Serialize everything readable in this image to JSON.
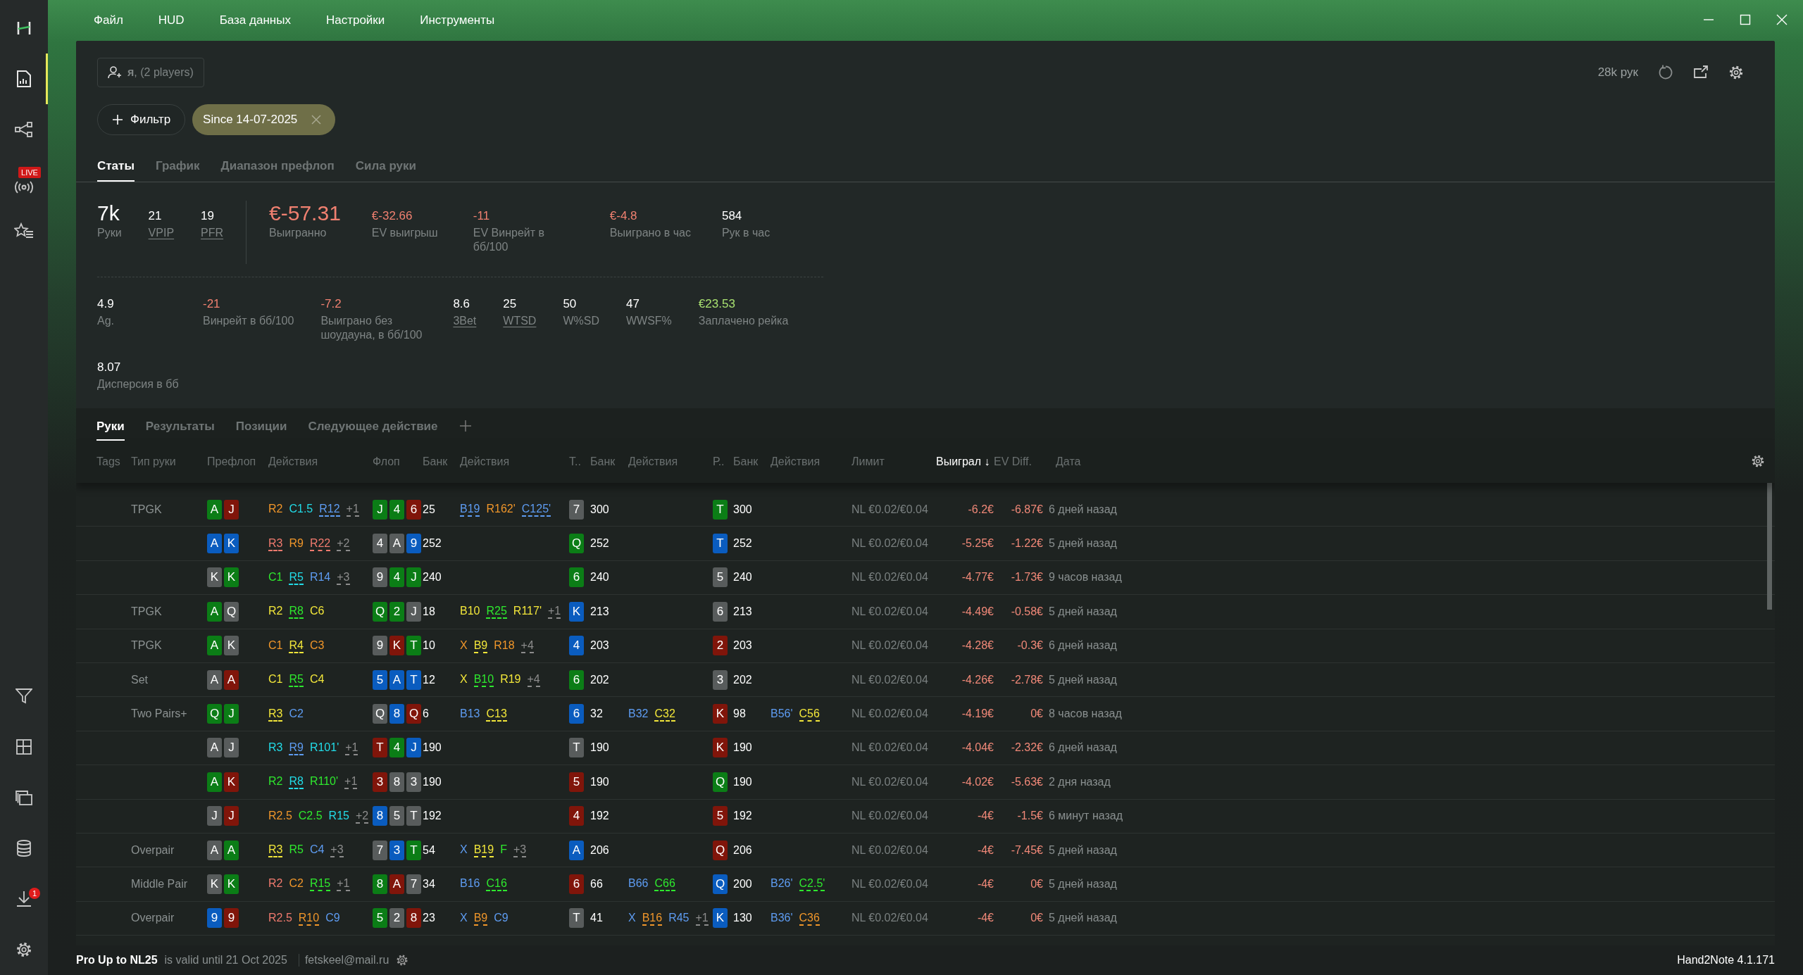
{
  "menu": [
    "Файл",
    "HUD",
    "База данных",
    "Настройки",
    "Инструменты"
  ],
  "sidebar": {
    "top": [
      {
        "kind": "logo",
        "selected": false
      },
      {
        "kind": "reports",
        "selected": true
      },
      {
        "kind": "graph",
        "selected": false
      },
      {
        "kind": "live",
        "selected": false,
        "badge": "LIVE"
      },
      {
        "kind": "favorites",
        "selected": false
      }
    ],
    "bottom": [
      {
        "kind": "filter",
        "selected": false
      },
      {
        "kind": "layout",
        "selected": false
      },
      {
        "kind": "cards",
        "selected": false
      },
      {
        "kind": "database",
        "selected": false
      },
      {
        "kind": "download",
        "selected": false,
        "badge": "1"
      },
      {
        "kind": "settings",
        "selected": false
      }
    ]
  },
  "player_selector": {
    "label": "**я**, (2 players)"
  },
  "filter_button": {
    "label": "Фильтр"
  },
  "filter_chip": {
    "label": "Since 14-07-2025"
  },
  "hands_count": "28k рук",
  "stat_tabs": [
    {
      "label": "Статы",
      "selected": true
    },
    {
      "label": "График",
      "selected": false
    },
    {
      "label": "Диапазон префлоп",
      "selected": false
    },
    {
      "label": "Сила руки",
      "selected": false
    }
  ],
  "stats_rows": [
    [
      {
        "value": "7k",
        "label": "Руки",
        "kind": "large",
        "color": "#ffffff",
        "underlined": false
      },
      {
        "value": "21",
        "label": "VPIP",
        "kind": "normal",
        "color": "#ffffff",
        "underlined": true
      },
      {
        "value": "19",
        "label": "PFR",
        "kind": "normal",
        "color": "#ffffff",
        "underlined": true
      },
      {
        "value": "€-57.31",
        "label": "Выигранно",
        "kind": "large",
        "color": "#f08070",
        "underlined": false
      },
      {
        "value": "€-32.66",
        "label": "EV выигрыш",
        "kind": "normal",
        "color": "#f08070",
        "underlined": false
      },
      {
        "value": "-11",
        "label": "EV Винрейт в бб/100",
        "kind": "normal",
        "color": "#f08070",
        "underlined": false
      },
      {
        "value": "€-4.8",
        "label": "Выиграно в час",
        "kind": "normal",
        "color": "#f08070",
        "underlined": false
      },
      {
        "value": "584",
        "label": "Рук в час",
        "kind": "normal",
        "color": "#ffffff",
        "underlined": false
      }
    ],
    [
      {
        "value": "4.9",
        "label": "Ag.",
        "kind": "normal",
        "color": "#ffffff",
        "underlined": false
      },
      {
        "value": "-21",
        "label": "Винрейт в бб/100",
        "kind": "normal",
        "color": "#f08070",
        "underlined": false
      },
      {
        "value": "-7.2",
        "label": "Выиграно без шоудауна, в бб/100",
        "kind": "normal",
        "color": "#f08070",
        "underlined": false
      },
      {
        "value": "8.6",
        "label": "3Bet",
        "kind": "normal",
        "color": "#ffffff",
        "underlined": true
      },
      {
        "value": "25",
        "label": "WTSD",
        "kind": "normal",
        "color": "#ffffff",
        "underlined": true
      },
      {
        "value": "50",
        "label": "W%SD",
        "kind": "normal",
        "color": "#ffffff",
        "underlined": false
      },
      {
        "value": "47",
        "label": "WWSF%",
        "kind": "normal",
        "color": "#ffffff",
        "underlined": false
      },
      {
        "value": "€23.53",
        "label": "Заплачено рейка",
        "kind": "normal",
        "color": "#a8e070",
        "underlined": false
      }
    ],
    [
      {
        "value": "8.07",
        "label": "Дисперсия в бб",
        "kind": "normal",
        "color": "#ffffff",
        "underlined": false
      }
    ]
  ],
  "hand_tabs": [
    {
      "label": "Руки",
      "selected": true
    },
    {
      "label": "Результаты",
      "selected": false
    },
    {
      "label": "Позиции",
      "selected": false
    },
    {
      "label": "Следующее действие",
      "selected": false
    }
  ],
  "table": {
    "columns": [
      {
        "label": "Tags",
        "sorted": false
      },
      {
        "label": "Тип руки",
        "sorted": false
      },
      {
        "label": "Префлоп",
        "sorted": false
      },
      {
        "label": "Действия",
        "sorted": false
      },
      {
        "label": "Флоп",
        "sorted": false
      },
      {
        "label": "Банк",
        "sorted": false
      },
      {
        "label": "Действия",
        "sorted": false
      },
      {
        "label": "Т..",
        "sorted": false
      },
      {
        "label": "Банк",
        "sorted": false
      },
      {
        "label": "Действия",
        "sorted": false
      },
      {
        "label": "Р..",
        "sorted": false
      },
      {
        "label": "Банк",
        "sorted": false
      },
      {
        "label": "Действия",
        "sorted": false
      },
      {
        "label": "Лимит",
        "sorted": false
      },
      {
        "label": "Выиграл ↓",
        "sorted": true
      },
      {
        "label": "EV Diff.",
        "sorted": false
      },
      {
        "label": "Дата",
        "sorted": false
      }
    ],
    "rows": [
      {
        "hand_type": "TPGK",
        "preflop_cards": [
          {
            "rank": "A",
            "color": "#0b7d16"
          },
          {
            "rank": "J",
            "color": "#80150a"
          }
        ],
        "preflop_actions": [
          {
            "text": "R2",
            "color": "#f0962a",
            "underlined": false
          },
          {
            "text": "C1.5",
            "color": "#22dce8",
            "underlined": false
          },
          {
            "text": "R12",
            "color": "#5e9cf2",
            "underlined": true
          },
          {
            "text": "+1",
            "color": "#8c8c8c",
            "underlined": true
          }
        ],
        "flop_cards": [
          {
            "rank": "J",
            "color": "#0b7d16"
          },
          {
            "rank": "4",
            "color": "#0b7d16"
          },
          {
            "rank": "6",
            "color": "#80150a"
          }
        ],
        "flop_pot": "25",
        "flop_actions": [
          {
            "text": "B19",
            "color": "#5e9cf2",
            "underlined": true
          },
          {
            "text": "R162'",
            "color": "#f0962a",
            "underlined": false
          },
          {
            "text": "C125'",
            "color": "#5e9cf2",
            "underlined": true
          }
        ],
        "turn_card": {
          "rank": "7",
          "color": "#585c5c"
        },
        "turn_pot": "300",
        "river_card": {
          "rank": "T",
          "color": "#0b7d16"
        },
        "river_pot": "300",
        "limit": "NL €0.02/€0.04",
        "won": "-6.2€",
        "ev_diff": "-6.87€",
        "date": "6 дней назад"
      },
      {
        "preflop_cards": [
          {
            "rank": "A",
            "color": "#0a5cbf"
          },
          {
            "rank": "K",
            "color": "#0a5cbf"
          }
        ],
        "preflop_actions": [
          {
            "text": "R3",
            "color": "#f07a6e",
            "underlined": true
          },
          {
            "text": "R9",
            "color": "#f0962a",
            "underlined": false
          },
          {
            "text": "R22",
            "color": "#f07a6e",
            "underlined": true
          },
          {
            "text": "+2",
            "color": "#8c8c8c",
            "underlined": true
          }
        ],
        "flop_cards": [
          {
            "rank": "4",
            "color": "#585c5c"
          },
          {
            "rank": "A",
            "color": "#585c5c"
          },
          {
            "rank": "9",
            "color": "#0a5cbf"
          }
        ],
        "flop_pot": "252",
        "turn_card": {
          "rank": "Q",
          "color": "#0b7d16"
        },
        "turn_pot": "252",
        "river_card": {
          "rank": "T",
          "color": "#0a5cbf"
        },
        "river_pot": "252",
        "limit": "NL €0.02/€0.04",
        "won": "-5.25€",
        "ev_diff": "-1.22€",
        "date": "5 дней назад"
      },
      {
        "preflop_cards": [
          {
            "rank": "K",
            "color": "#585c5c"
          },
          {
            "rank": "K",
            "color": "#0b7d16"
          }
        ],
        "preflop_actions": [
          {
            "text": "C1",
            "color": "#2ee82e",
            "underlined": false
          },
          {
            "text": "R5",
            "color": "#22dce8",
            "underlined": true
          },
          {
            "text": "R14",
            "color": "#5e9cf2",
            "underlined": false
          },
          {
            "text": "+3",
            "color": "#8c8c8c",
            "underlined": true
          }
        ],
        "flop_cards": [
          {
            "rank": "9",
            "color": "#585c5c"
          },
          {
            "rank": "4",
            "color": "#0b7d16"
          },
          {
            "rank": "J",
            "color": "#0b7d16"
          }
        ],
        "flop_pot": "240",
        "turn_card": {
          "rank": "6",
          "color": "#0b7d16"
        },
        "turn_pot": "240",
        "river_card": {
          "rank": "5",
          "color": "#585c5c"
        },
        "river_pot": "240",
        "limit": "NL €0.02/€0.04",
        "won": "-4.77€",
        "ev_diff": "-1.73€",
        "date": "9 часов назад"
      },
      {
        "hand_type": "TPGK",
        "preflop_cards": [
          {
            "rank": "A",
            "color": "#0b7d16"
          },
          {
            "rank": "Q",
            "color": "#585c5c"
          }
        ],
        "preflop_actions": [
          {
            "text": "R2",
            "color": "#f2e63a",
            "underlined": false
          },
          {
            "text": "R8",
            "color": "#2ee82e",
            "underlined": true
          },
          {
            "text": "C6",
            "color": "#f2e63a",
            "underlined": false
          }
        ],
        "flop_cards": [
          {
            "rank": "Q",
            "color": "#0b7d16"
          },
          {
            "rank": "2",
            "color": "#0b7d16"
          },
          {
            "rank": "J",
            "color": "#585c5c"
          }
        ],
        "flop_pot": "18",
        "flop_actions": [
          {
            "text": "B10",
            "color": "#f2e63a",
            "underlined": false
          },
          {
            "text": "R25",
            "color": "#2ee82e",
            "underlined": true
          },
          {
            "text": "R117'",
            "color": "#f2e63a",
            "underlined": false
          },
          {
            "text": "+1",
            "color": "#8c8c8c",
            "underlined": true
          }
        ],
        "turn_card": {
          "rank": "K",
          "color": "#0a5cbf"
        },
        "turn_pot": "213",
        "river_card": {
          "rank": "6",
          "color": "#585c5c"
        },
        "river_pot": "213",
        "limit": "NL €0.02/€0.04",
        "won": "-4.49€",
        "ev_diff": "-0.58€",
        "date": "5 дней назад"
      },
      {
        "hand_type": "TPGK",
        "preflop_cards": [
          {
            "rank": "A",
            "color": "#0b7d16"
          },
          {
            "rank": "K",
            "color": "#585c5c"
          }
        ],
        "preflop_actions": [
          {
            "text": "C1",
            "color": "#f0962a",
            "underlined": false
          },
          {
            "text": "R4",
            "color": "#f2e63a",
            "underlined": true
          },
          {
            "text": "C3",
            "color": "#f0962a",
            "underlined": false
          }
        ],
        "flop_cards": [
          {
            "rank": "9",
            "color": "#585c5c"
          },
          {
            "rank": "K",
            "color": "#80150a"
          },
          {
            "rank": "T",
            "color": "#0b7d16"
          }
        ],
        "flop_pot": "10",
        "flop_actions": [
          {
            "text": "X",
            "color": "#f0962a",
            "underlined": false
          },
          {
            "text": "B9",
            "color": "#f2e63a",
            "underlined": true
          },
          {
            "text": "R18",
            "color": "#f0962a",
            "underlined": false
          },
          {
            "text": "+4",
            "color": "#8c8c8c",
            "underlined": true
          }
        ],
        "turn_card": {
          "rank": "4",
          "color": "#0a5cbf"
        },
        "turn_pot": "203",
        "river_card": {
          "rank": "2",
          "color": "#80150a"
        },
        "river_pot": "203",
        "limit": "NL €0.02/€0.04",
        "won": "-4.28€",
        "ev_diff": "-0.3€",
        "date": "6 дней назад"
      },
      {
        "hand_type": "Set",
        "preflop_cards": [
          {
            "rank": "A",
            "color": "#585c5c"
          },
          {
            "rank": "A",
            "color": "#80150a"
          }
        ],
        "preflop_actions": [
          {
            "text": "C1",
            "color": "#f2e63a",
            "underlined": false
          },
          {
            "text": "R5",
            "color": "#2ee82e",
            "underlined": true
          },
          {
            "text": "C4",
            "color": "#f2e63a",
            "underlined": false
          }
        ],
        "flop_cards": [
          {
            "rank": "5",
            "color": "#0a5cbf"
          },
          {
            "rank": "A",
            "color": "#0a5cbf"
          },
          {
            "rank": "T",
            "color": "#0a5cbf"
          }
        ],
        "flop_pot": "12",
        "flop_actions": [
          {
            "text": "X",
            "color": "#f2e63a",
            "underlined": false
          },
          {
            "text": "B10",
            "color": "#2ee82e",
            "underlined": true
          },
          {
            "text": "R19",
            "color": "#f2e63a",
            "underlined": false
          },
          {
            "text": "+4",
            "color": "#8c8c8c",
            "underlined": true
          }
        ],
        "turn_card": {
          "rank": "6",
          "color": "#0b7d16"
        },
        "turn_pot": "202",
        "river_card": {
          "rank": "3",
          "color": "#585c5c"
        },
        "river_pot": "202",
        "limit": "NL €0.02/€0.04",
        "won": "-4.26€",
        "ev_diff": "-2.78€",
        "date": "5 дней назад"
      },
      {
        "hand_type": "Two Pairs+",
        "preflop_cards": [
          {
            "rank": "Q",
            "color": "#0b7d16"
          },
          {
            "rank": "J",
            "color": "#0b7d16"
          }
        ],
        "preflop_actions": [
          {
            "text": "R3",
            "color": "#f2e63a",
            "underlined": true
          },
          {
            "text": "C2",
            "color": "#5e9cf2",
            "underlined": false
          }
        ],
        "flop_cards": [
          {
            "rank": "Q",
            "color": "#585c5c"
          },
          {
            "rank": "8",
            "color": "#0a5cbf"
          },
          {
            "rank": "Q",
            "color": "#80150a"
          }
        ],
        "flop_pot": "6",
        "flop_actions": [
          {
            "text": "B13",
            "color": "#5e9cf2",
            "underlined": false
          },
          {
            "text": "C13",
            "color": "#f2e63a",
            "underlined": true
          }
        ],
        "turn_card": {
          "rank": "6",
          "color": "#0a5cbf"
        },
        "turn_pot": "32",
        "turn_actions": [
          {
            "text": "B32",
            "color": "#5e9cf2",
            "underlined": false
          },
          {
            "text": "C32",
            "color": "#f2e63a",
            "underlined": true
          }
        ],
        "river_card": {
          "rank": "K",
          "color": "#80150a"
        },
        "river_pot": "98",
        "river_actions": [
          {
            "text": "B56'",
            "color": "#5e9cf2",
            "underlined": false
          },
          {
            "text": "C56",
            "color": "#f2e63a",
            "underlined": true
          }
        ],
        "limit": "NL €0.02/€0.04",
        "won": "-4.19€",
        "ev_diff": "0€",
        "date": "8 часов назад"
      },
      {
        "preflop_cards": [
          {
            "rank": "A",
            "color": "#585c5c"
          },
          {
            "rank": "J",
            "color": "#585c5c"
          }
        ],
        "preflop_actions": [
          {
            "text": "R3",
            "color": "#22dce8",
            "underlined": false
          },
          {
            "text": "R9",
            "color": "#5e9cf2",
            "underlined": true
          },
          {
            "text": "R101'",
            "color": "#22dce8",
            "underlined": false
          },
          {
            "text": "+1",
            "color": "#8c8c8c",
            "underlined": true
          }
        ],
        "flop_cards": [
          {
            "rank": "T",
            "color": "#80150a"
          },
          {
            "rank": "4",
            "color": "#0b7d16"
          },
          {
            "rank": "J",
            "color": "#0a5cbf"
          }
        ],
        "flop_pot": "190",
        "turn_card": {
          "rank": "T",
          "color": "#585c5c"
        },
        "turn_pot": "190",
        "river_card": {
          "rank": "K",
          "color": "#80150a"
        },
        "river_pot": "190",
        "limit": "NL €0.02/€0.04",
        "won": "-4.04€",
        "ev_diff": "-2.32€",
        "date": "6 дней назад"
      },
      {
        "preflop_cards": [
          {
            "rank": "A",
            "color": "#0b7d16"
          },
          {
            "rank": "K",
            "color": "#80150a"
          }
        ],
        "preflop_actions": [
          {
            "text": "R2",
            "color": "#2ee82e",
            "underlined": false
          },
          {
            "text": "R8",
            "color": "#22dce8",
            "underlined": true
          },
          {
            "text": "R110'",
            "color": "#2ee82e",
            "underlined": false
          },
          {
            "text": "+1",
            "color": "#8c8c8c",
            "underlined": true
          }
        ],
        "flop_cards": [
          {
            "rank": "3",
            "color": "#80150a"
          },
          {
            "rank": "8",
            "color": "#585c5c"
          },
          {
            "rank": "3",
            "color": "#585c5c"
          }
        ],
        "flop_pot": "190",
        "turn_card": {
          "rank": "5",
          "color": "#80150a"
        },
        "turn_pot": "190",
        "river_card": {
          "rank": "Q",
          "color": "#0b7d16"
        },
        "river_pot": "190",
        "limit": "NL €0.02/€0.04",
        "won": "-4.02€",
        "ev_diff": "-5.63€",
        "date": "2 дня назад"
      },
      {
        "preflop_cards": [
          {
            "rank": "J",
            "color": "#585c5c"
          },
          {
            "rank": "J",
            "color": "#80150a"
          }
        ],
        "preflop_actions": [
          {
            "text": "R2.5",
            "color": "#f0962a",
            "underlined": false
          },
          {
            "text": "C2.5",
            "color": "#2ee82e",
            "underlined": false
          },
          {
            "text": "R15",
            "color": "#22dce8",
            "underlined": false
          },
          {
            "text": "+2",
            "color": "#8c8c8c",
            "underlined": true
          }
        ],
        "flop_cards": [
          {
            "rank": "8",
            "color": "#0a5cbf"
          },
          {
            "rank": "5",
            "color": "#585c5c"
          },
          {
            "rank": "T",
            "color": "#585c5c"
          }
        ],
        "flop_pot": "192",
        "turn_card": {
          "rank": "4",
          "color": "#80150a"
        },
        "turn_pot": "192",
        "river_card": {
          "rank": "5",
          "color": "#80150a"
        },
        "river_pot": "192",
        "limit": "NL €0.02/€0.04",
        "won": "-4€",
        "ev_diff": "-1.5€",
        "date": "6 минут назад"
      },
      {
        "hand_type": "Overpair",
        "preflop_cards": [
          {
            "rank": "A",
            "color": "#585c5c"
          },
          {
            "rank": "A",
            "color": "#0b7d16"
          }
        ],
        "preflop_actions": [
          {
            "text": "R3",
            "color": "#f2e63a",
            "underlined": true
          },
          {
            "text": "R5",
            "color": "#2ee82e",
            "underlined": false
          },
          {
            "text": "C4",
            "color": "#5e9cf2",
            "underlined": false
          },
          {
            "text": "+3",
            "color": "#8c8c8c",
            "underlined": true
          }
        ],
        "flop_cards": [
          {
            "rank": "7",
            "color": "#585c5c"
          },
          {
            "rank": "3",
            "color": "#0a5cbf"
          },
          {
            "rank": "T",
            "color": "#0b7d16"
          }
        ],
        "flop_pot": "54",
        "flop_actions": [
          {
            "text": "X",
            "color": "#5e9cf2",
            "underlined": false
          },
          {
            "text": "B19",
            "color": "#f2e63a",
            "underlined": true
          },
          {
            "text": "F",
            "color": "#2ee82e",
            "underlined": false
          },
          {
            "text": "+3",
            "color": "#8c8c8c",
            "underlined": true
          }
        ],
        "turn_card": {
          "rank": "A",
          "color": "#0a5cbf"
        },
        "turn_pot": "206",
        "river_card": {
          "rank": "Q",
          "color": "#80150a"
        },
        "river_pot": "206",
        "limit": "NL €0.02/€0.04",
        "won": "-4€",
        "ev_diff": "-7.45€",
        "date": "5 дней назад"
      },
      {
        "hand_type": "Middle Pair",
        "preflop_cards": [
          {
            "rank": "K",
            "color": "#585c5c"
          },
          {
            "rank": "K",
            "color": "#0b7d16"
          }
        ],
        "preflop_actions": [
          {
            "text": "R2",
            "color": "#f07a6e",
            "underlined": false
          },
          {
            "text": "C2",
            "color": "#f0962a",
            "underlined": false
          },
          {
            "text": "R15",
            "color": "#2ee82e",
            "underlined": true
          },
          {
            "text": "+1",
            "color": "#8c8c8c",
            "underlined": true
          }
        ],
        "flop_cards": [
          {
            "rank": "8",
            "color": "#0b7d16"
          },
          {
            "rank": "A",
            "color": "#80150a"
          },
          {
            "rank": "7",
            "color": "#585c5c"
          }
        ],
        "flop_pot": "34",
        "flop_actions": [
          {
            "text": "B16",
            "color": "#5e9cf2",
            "underlined": false
          },
          {
            "text": "C16",
            "color": "#2ee82e",
            "underlined": true
          }
        ],
        "turn_card": {
          "rank": "6",
          "color": "#80150a"
        },
        "turn_pot": "66",
        "turn_actions": [
          {
            "text": "B66",
            "color": "#5e9cf2",
            "underlined": false
          },
          {
            "text": "C66",
            "color": "#2ee82e",
            "underlined": true
          }
        ],
        "river_card": {
          "rank": "Q",
          "color": "#0a5cbf"
        },
        "river_pot": "200",
        "river_actions": [
          {
            "text": "B26'",
            "color": "#5e9cf2",
            "underlined": false
          },
          {
            "text": "C2.5'",
            "color": "#2ee82e",
            "underlined": true
          }
        ],
        "limit": "NL €0.02/€0.04",
        "won": "-4€",
        "ev_diff": "0€",
        "date": "5 дней назад"
      },
      {
        "hand_type": "Overpair",
        "preflop_cards": [
          {
            "rank": "9",
            "color": "#0a5cbf"
          },
          {
            "rank": "9",
            "color": "#80150a"
          }
        ],
        "preflop_actions": [
          {
            "text": "R2.5",
            "color": "#f07a6e",
            "underlined": false
          },
          {
            "text": "R10",
            "color": "#f0962a",
            "underlined": true
          },
          {
            "text": "C9",
            "color": "#5e9cf2",
            "underlined": false
          }
        ],
        "flop_cards": [
          {
            "rank": "5",
            "color": "#0b7d16"
          },
          {
            "rank": "2",
            "color": "#585c5c"
          },
          {
            "rank": "8",
            "color": "#80150a"
          }
        ],
        "flop_pot": "23",
        "flop_actions": [
          {
            "text": "X",
            "color": "#5e9cf2",
            "underlined": false
          },
          {
            "text": "B9",
            "color": "#f0962a",
            "underlined": true
          },
          {
            "text": "C9",
            "color": "#5e9cf2",
            "underlined": false
          }
        ],
        "turn_card": {
          "rank": "T",
          "color": "#585c5c"
        },
        "turn_pot": "41",
        "turn_actions": [
          {
            "text": "X",
            "color": "#5e9cf2",
            "underlined": false
          },
          {
            "text": "B16",
            "color": "#f0962a",
            "underlined": true
          },
          {
            "text": "R45",
            "color": "#5e9cf2",
            "underlined": false
          },
          {
            "text": "+1",
            "color": "#8c8c8c",
            "underlined": true
          }
        ],
        "river_card": {
          "rank": "K",
          "color": "#0a5cbf"
        },
        "river_pot": "130",
        "river_actions": [
          {
            "text": "B36'",
            "color": "#5e9cf2",
            "underlined": false
          },
          {
            "text": "C36",
            "color": "#f0962a",
            "underlined": true
          }
        ],
        "limit": "NL €0.02/€0.04",
        "won": "-4€",
        "ev_diff": "0€",
        "date": "5 дней назад"
      }
    ]
  },
  "status_bar": {
    "license": "Pro Up to NL25",
    "validity": "is valid until 21 Oct 2025",
    "email": "fetskeel@mail.ru",
    "version": "Hand2Note 4.1.171"
  }
}
